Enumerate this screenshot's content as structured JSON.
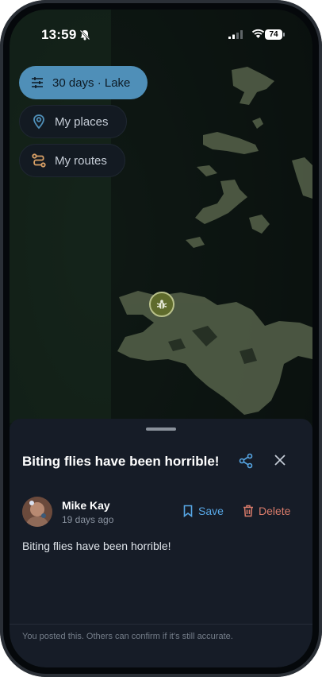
{
  "status_bar": {
    "time": "13:59",
    "battery": "74",
    "bell_icon": "bell-slash-icon",
    "signal_icon": "cellular-signal-icon",
    "wifi_icon": "wifi-icon"
  },
  "filters": [
    {
      "label": "30 days · Lake",
      "icon": "sliders-icon"
    },
    {
      "label": "My places",
      "icon": "map-pin-icon"
    },
    {
      "label": "My routes",
      "icon": "route-icon"
    }
  ],
  "map_pin": {
    "icon": "bug-icon"
  },
  "sheet": {
    "title": "Biting flies have been horrible!",
    "share_icon": "share-icon",
    "close_icon": "close-icon",
    "author": "Mike Kay",
    "posted": "19 days ago",
    "save_label": "Save",
    "delete_label": "Delete",
    "body": "Biting flies have been horrible!",
    "footer": "You posted this. Others can confirm if it's still accurate."
  },
  "colors": {
    "accent": "#57a7e6",
    "filter_active": "#4f8fb8",
    "delete": "#d97b6a",
    "sheet_bg": "#161c27"
  }
}
